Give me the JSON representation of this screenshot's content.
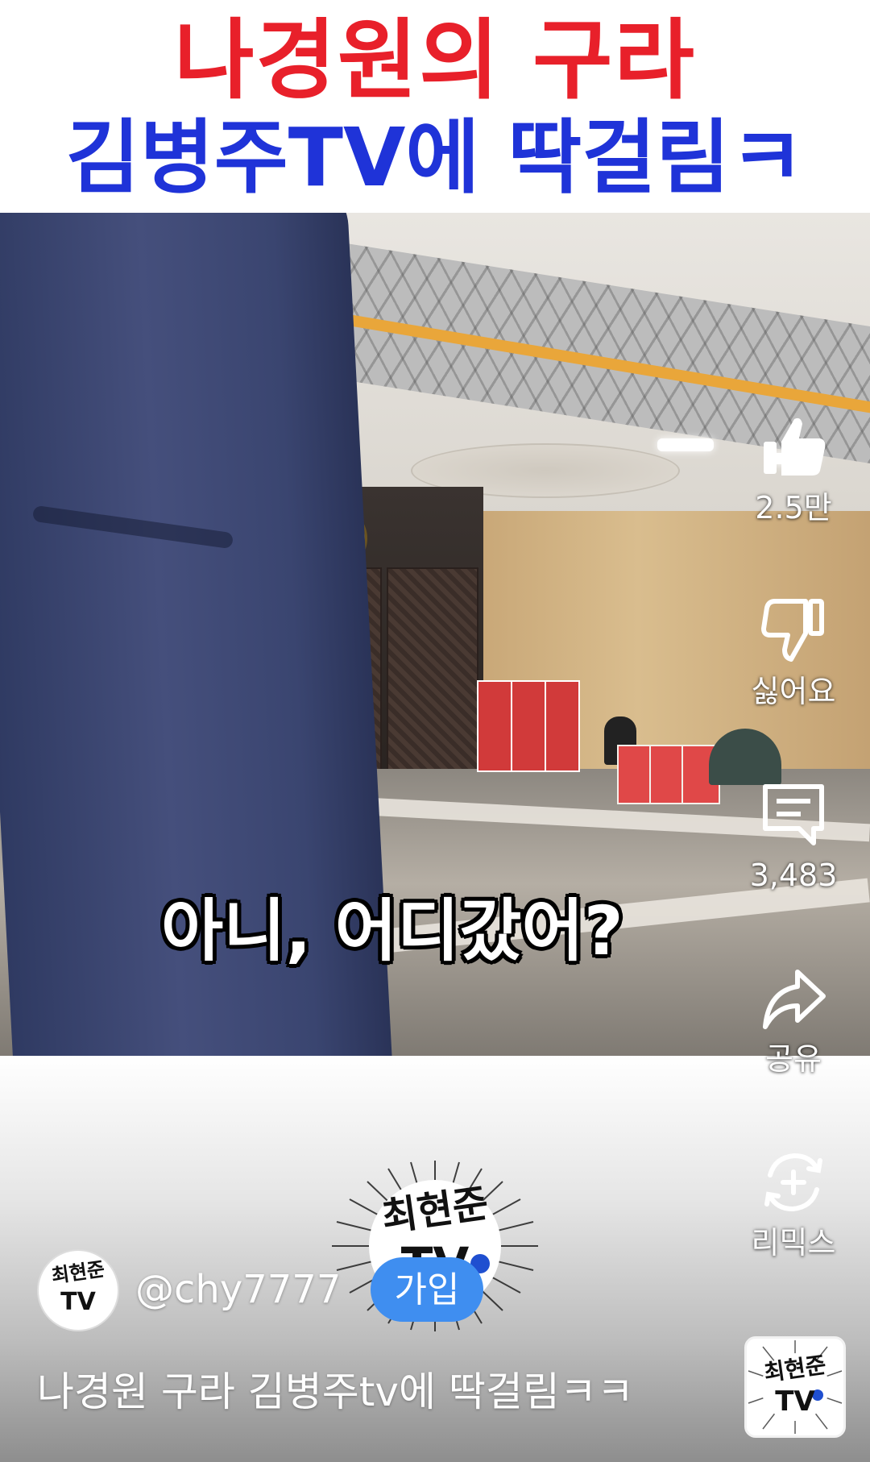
{
  "title_banner": {
    "line1": "나경원의 구라",
    "line2": "김병주TV에 딱걸림ㅋ"
  },
  "video": {
    "caption": "아니, 어디갔어?"
  },
  "actions": {
    "like": {
      "icon": "thumbs-up-icon",
      "label": "2.5만"
    },
    "dislike": {
      "icon": "thumbs-down-icon",
      "label": "싫어요"
    },
    "comments": {
      "icon": "comment-icon",
      "label": "3,483"
    },
    "share": {
      "icon": "share-icon",
      "label": "공유"
    },
    "remix": {
      "icon": "remix-icon",
      "label": "리믹스"
    }
  },
  "channel": {
    "handle": "@chy7777",
    "join_label": "가입",
    "logo_line1": "최현준",
    "logo_line2": "TV"
  },
  "short": {
    "title": "나경원 구라 김병주tv에 딱걸림ㅋㅋ"
  },
  "colors": {
    "title_red": "#e8202a",
    "title_blue": "#1f33d8",
    "join_blue": "#3f8ef0"
  }
}
